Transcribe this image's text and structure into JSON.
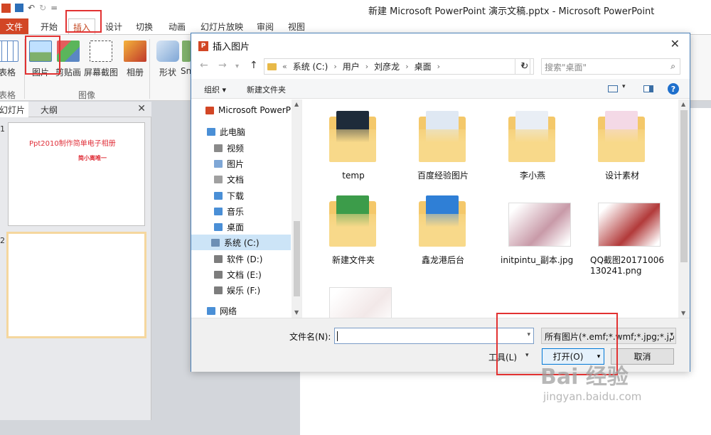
{
  "titlebar": {
    "title": "新建 Microsoft PowerPoint 演示文稿.pptx - Microsoft PowerPoint",
    "qat_sep": "="
  },
  "ribbon_tabs": {
    "file": "文件",
    "home": "开始",
    "insert": "插入",
    "design": "设计",
    "transitions": "切换",
    "animations": "动画",
    "slideshow": "幻灯片放映",
    "review": "审阅",
    "view": "视图"
  },
  "ribbon": {
    "table": "表格",
    "picture": "图片",
    "clipart": "剪贴画",
    "screenshot": "屏幕截图",
    "album": "相册",
    "shapes": "形状",
    "smartart": "Sn",
    "group_table": "表格",
    "group_images": "图像"
  },
  "slides_panel": {
    "tab_slides": "幻灯片",
    "tab_outline": "大纲",
    "close": "✕",
    "slides": [
      {
        "num": "1",
        "title": "Ppt2010制作简单电子相册",
        "subtitle": "简小离唯一"
      },
      {
        "num": "2"
      }
    ]
  },
  "dialog": {
    "title": "插入图片",
    "close": "✕",
    "breadcrumb": {
      "prefix": "«",
      "items": [
        "系统 (C:)",
        "用户",
        "刘彦龙",
        "桌面"
      ]
    },
    "search_placeholder": "搜索\"桌面\"",
    "commands": {
      "organize": "组织 ▾",
      "new_folder": "新建文件夹",
      "help": "?"
    },
    "nav_items": [
      {
        "label": "Microsoft PowerP",
        "icon": "powerpoint-icon",
        "color": "#d24625"
      },
      {
        "label": "此电脑",
        "icon": "pc-icon",
        "color": "#4a8fd6"
      },
      {
        "label": "视频",
        "icon": "video-folder-icon",
        "color": "#8a8a8a"
      },
      {
        "label": "图片",
        "icon": "pictures-folder-icon",
        "color": "#7fa7d6"
      },
      {
        "label": "文档",
        "icon": "documents-folder-icon",
        "color": "#a0a0a0"
      },
      {
        "label": "下载",
        "icon": "downloads-folder-icon",
        "color": "#4a8fd6"
      },
      {
        "label": "音乐",
        "icon": "music-folder-icon",
        "color": "#4a8fd6"
      },
      {
        "label": "桌面",
        "icon": "desktop-folder-icon",
        "color": "#4a8fd6"
      },
      {
        "label": "系统 (C:)",
        "icon": "system-drive-icon",
        "color": "#6d8fb5"
      },
      {
        "label": "软件 (D:)",
        "icon": "drive-icon",
        "color": "#7d7d7d"
      },
      {
        "label": "文档 (E:)",
        "icon": "drive-icon",
        "color": "#7d7d7d"
      },
      {
        "label": "娱乐 (F:)",
        "icon": "drive-icon",
        "color": "#7d7d7d"
      },
      {
        "label": "网络",
        "icon": "network-icon",
        "color": "#4a8fd6"
      }
    ],
    "files": [
      {
        "name": "temp",
        "kind": "folder",
        "preview": "#1e2b3a"
      },
      {
        "name": "百度经验图片",
        "kind": "folder",
        "preview": "#dfe8f3"
      },
      {
        "name": "李小燕",
        "kind": "folder",
        "preview": "#e9eef5"
      },
      {
        "name": "设计素材",
        "kind": "folder",
        "preview": "#f4d9e6"
      },
      {
        "name": "新建文件夹",
        "kind": "folder",
        "preview": "#3c9c4a"
      },
      {
        "name": "鑫龙港后台",
        "kind": "folder",
        "preview": "#2f7fd6"
      },
      {
        "name": "initpintu_副本.jpg",
        "kind": "image",
        "preview": "#c89aa8"
      },
      {
        "name": "QQ截图20171006130241.png",
        "kind": "image",
        "preview": "#b23a3a"
      },
      {
        "name": "",
        "kind": "image",
        "preview": "#f2e8e8"
      }
    ],
    "filename_label": "文件名(N):",
    "filename_value": "",
    "filetype": "所有图片(*.emf;*.wmf;*.jpg;*.jp",
    "tools": "工具(L)",
    "open": "打开(O)",
    "cancel": "取消"
  },
  "watermark": {
    "brand": "Bai  经验",
    "url": "jingyan.baidu.com"
  },
  "colors": {
    "accent_red": "#e23232",
    "file_tab": "#d24625",
    "selection": "#cce4f7"
  }
}
